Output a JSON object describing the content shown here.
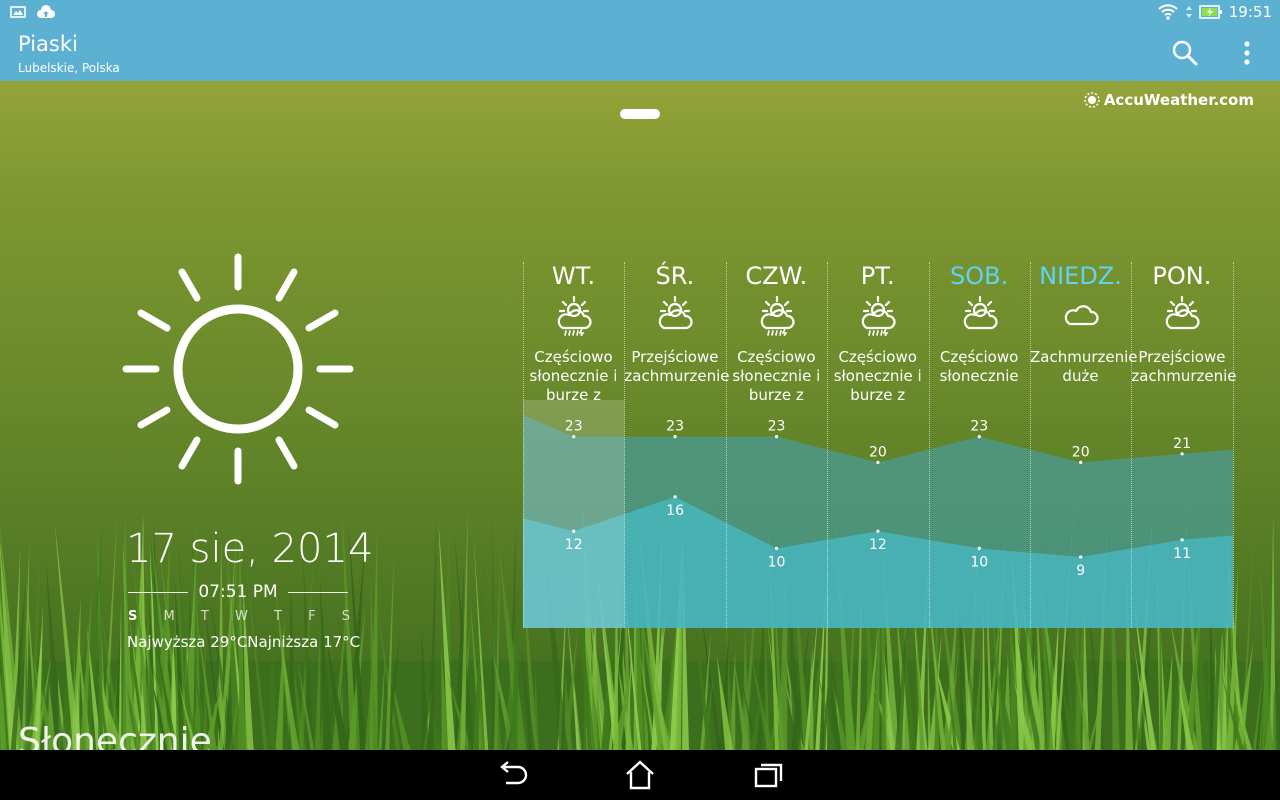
{
  "status_bar": {
    "time": "19:51",
    "icons": [
      "gallery-icon",
      "cloud-upload-icon",
      "wifi-icon",
      "battery-charging-icon"
    ]
  },
  "header": {
    "city": "Piaski",
    "region": "Lubelskie, Polska",
    "actions": [
      "search-icon",
      "overflow-menu-icon"
    ]
  },
  "brand": {
    "label": "AccuWeather.com"
  },
  "current": {
    "date": "17 sie, 2014",
    "time": "07:51 PM",
    "weekdays": [
      "S",
      "M",
      "T",
      "W",
      "T",
      "F",
      "S"
    ],
    "active_weekday_index": 0,
    "hi_lo": "Najwyższa 29°CNajniższa 17°C",
    "condition": "Słonecznie",
    "icon": "sun-icon"
  },
  "forecast": {
    "days": [
      {
        "name": "WT.",
        "desc": "Częściowo słonecznie i burze z",
        "icon": "partly-sunny-storm-icon",
        "high": 23,
        "low": 12,
        "weekend": false
      },
      {
        "name": "ŚR.",
        "desc": "Przejściowe zachmurzenie",
        "icon": "partly-cloudy-icon",
        "high": 23,
        "low": 16,
        "weekend": false
      },
      {
        "name": "CZW.",
        "desc": "Częściowo słonecznie i burze z",
        "icon": "partly-sunny-storm-icon",
        "high": 23,
        "low": 10,
        "weekend": false
      },
      {
        "name": "PT.",
        "desc": "Częściowo słonecznie i burze z",
        "icon": "partly-sunny-storm-icon",
        "high": 20,
        "low": 12,
        "weekend": false
      },
      {
        "name": "SOB.",
        "desc": "Częściowo słonecznie",
        "icon": "partly-cloudy-icon",
        "high": 23,
        "low": 10,
        "weekend": true
      },
      {
        "name": "NIEDZ.",
        "desc": "Zachmurzenie duże",
        "icon": "cloud-icon",
        "high": 20,
        "low": 9,
        "weekend": true
      },
      {
        "name": "PON.",
        "desc": "Przejściowe zachmurzenie",
        "icon": "partly-cloudy-icon",
        "high": 21,
        "low": 11,
        "weekend": false
      }
    ],
    "colors": {
      "weekend": "#5fd3f2",
      "high_area": "#4a9b99",
      "low_area": "#46c3d6"
    }
  },
  "nav": {
    "buttons": [
      "back-icon",
      "home-icon",
      "recent-apps-icon"
    ]
  }
}
